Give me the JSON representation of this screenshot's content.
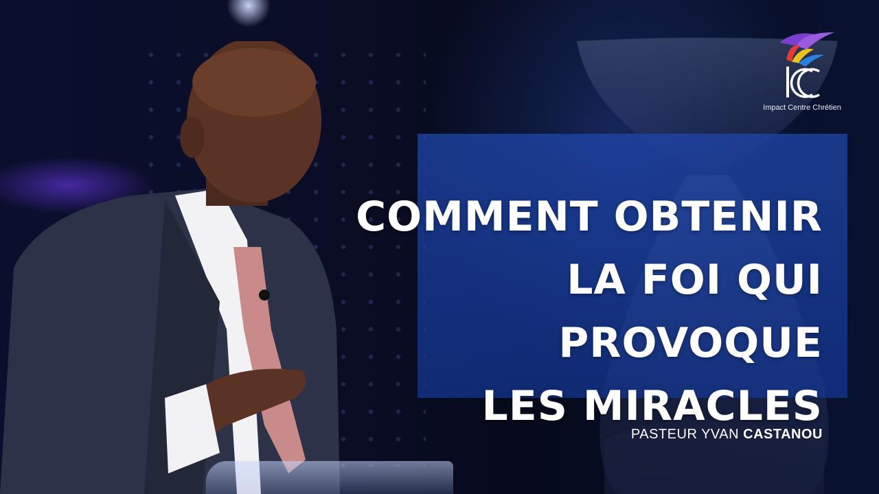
{
  "title": {
    "line1": "COMMENT OBTENIR",
    "line2": "LA FOI QUI PROVOQUE",
    "line3": "LES MIRACLES"
  },
  "speaker": {
    "role": "PASTEUR YVAN",
    "surname": "CASTANOU"
  },
  "logo": {
    "monogram": "ICC",
    "name": "Impact Centre Chrétien"
  },
  "colors": {
    "panel": "#1e46aa",
    "background": "#0a0f2e",
    "logo_purple": "#7b3fd0",
    "logo_yellow": "#e8c21c",
    "logo_blue": "#2a7fe0",
    "logo_red": "#e03a3a"
  }
}
